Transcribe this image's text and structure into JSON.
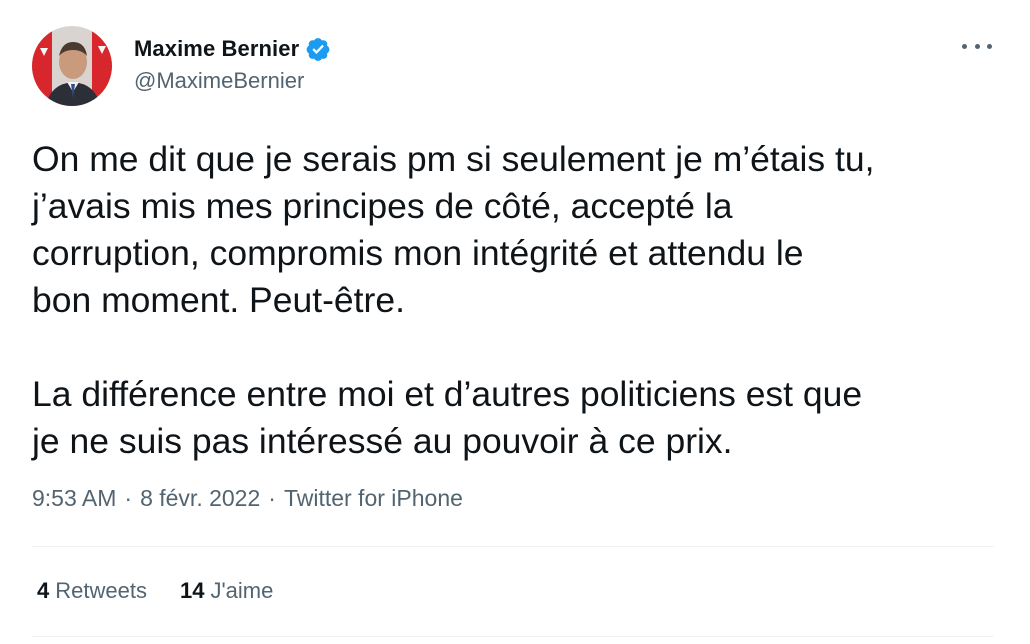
{
  "author": {
    "name": "Maxime Bernier",
    "handle": "@MaximeBernier",
    "verified_color": "#1d9bf0"
  },
  "tweet": {
    "text": "On me dit que je serais pm si seulement je m’étais tu,\nj’avais mis mes principes de côté, accepté la\ncorruption, compromis mon intégrité et attendu le\nbon moment. Peut-être.\n\nLa différence entre moi et d’autres politiciens est que\nje ne suis pas intéressé au pouvoir à ce prix.",
    "time": "9:53 AM",
    "date": "8 févr. 2022",
    "source": "Twitter for iPhone",
    "separator": "·"
  },
  "stats": {
    "retweets_count": "4",
    "retweets_label": "Retweets",
    "likes_count": "14",
    "likes_label": "J'aime"
  },
  "icons": {
    "more": "more-horizontal-icon",
    "verified": "verified-badge-icon"
  }
}
